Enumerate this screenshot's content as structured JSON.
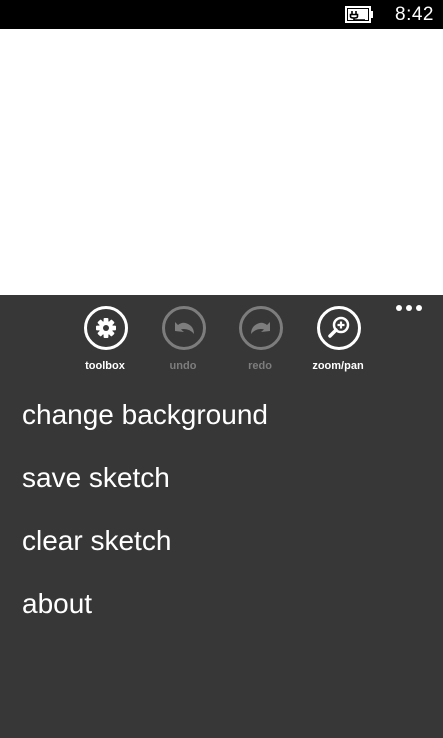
{
  "status_bar": {
    "time": "8:42",
    "battery_icon": "battery-charging-icon"
  },
  "app_bar": {
    "more_icon": "ellipsis-icon",
    "buttons": [
      {
        "label": "toolbox",
        "icon": "gear-icon",
        "enabled": true
      },
      {
        "label": "undo",
        "icon": "undo-arrow-icon",
        "enabled": false
      },
      {
        "label": "redo",
        "icon": "redo-arrow-icon",
        "enabled": false
      },
      {
        "label": "zoom/pan",
        "icon": "zoom-in-icon",
        "enabled": true
      }
    ],
    "menu_items": [
      "change background",
      "save sketch",
      "clear sketch",
      "about"
    ]
  },
  "colors": {
    "status_bar_bg": "#000000",
    "canvas_bg": "#ffffff",
    "app_bar_bg": "#373737",
    "text": "#ffffff",
    "disabled": "#7d7d7d"
  }
}
